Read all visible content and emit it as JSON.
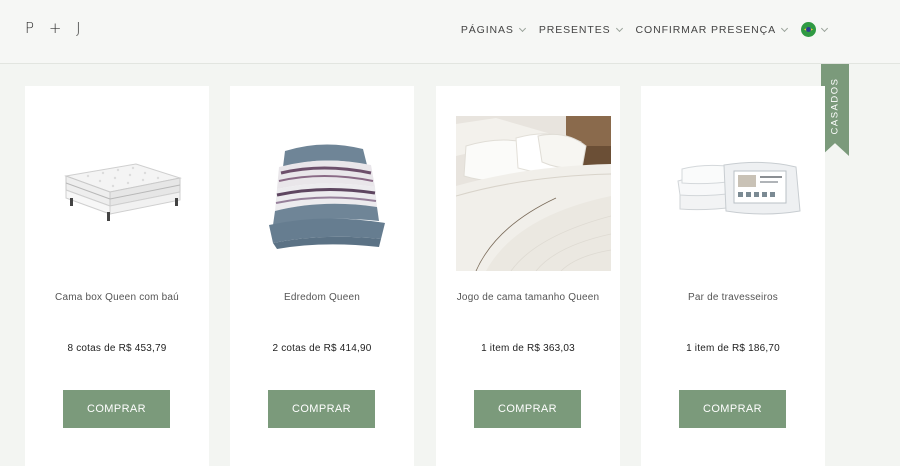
{
  "header": {
    "logo": "P + J",
    "nav": [
      {
        "label": "PÁGINAS"
      },
      {
        "label": "PRESENTES"
      },
      {
        "label": "CONFIRMAR PRESENÇA"
      }
    ],
    "language_flag": "brazil-flag-icon"
  },
  "ribbon": {
    "label": "CASADOS"
  },
  "products": [
    {
      "name": "Cama box Queen com baú",
      "price": "8 cotas de R$ 453,79",
      "button": "COMPRAR",
      "image": "bed-mattress-image"
    },
    {
      "name": "Edredom Queen",
      "price": "2 cotas de R$ 414,90",
      "button": "COMPRAR",
      "image": "folded-comforter-image"
    },
    {
      "name": "Jogo de cama tamanho Queen",
      "price": "1 item de R$ 363,03",
      "button": "COMPRAR",
      "image": "bed-linen-set-image"
    },
    {
      "name": "Par de travesseiros",
      "price": "1 item de R$ 186,70",
      "button": "COMPRAR",
      "image": "pillows-pair-image"
    }
  ],
  "colors": {
    "accent": "#7b9a7b",
    "background": "#f3f5f2",
    "card": "#ffffff"
  }
}
